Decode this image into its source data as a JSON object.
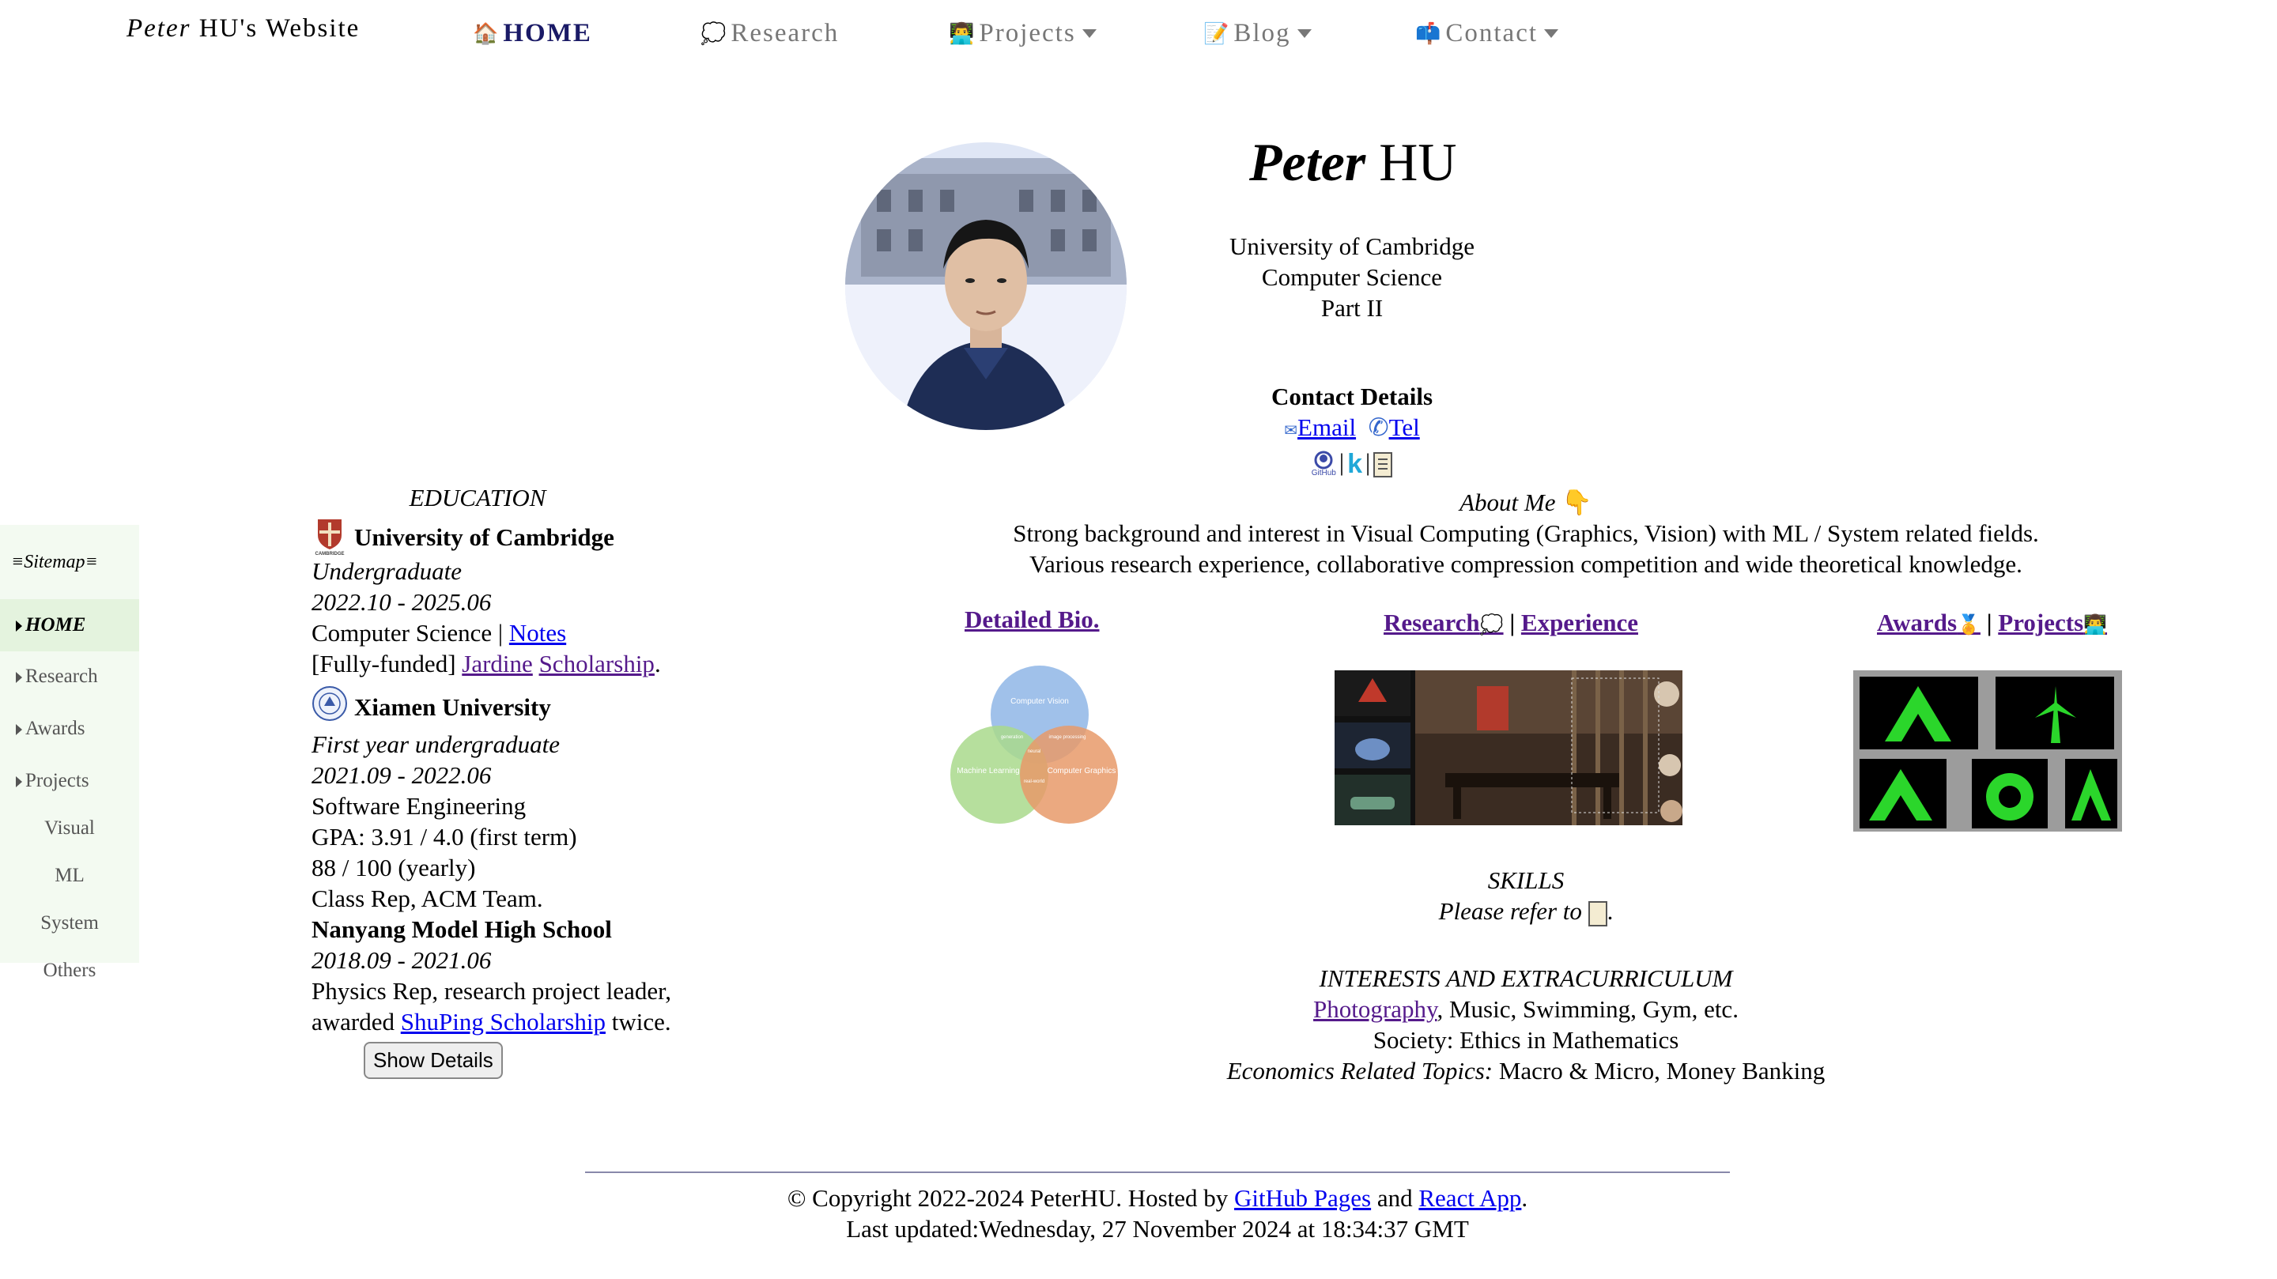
{
  "nav": {
    "brand_italic": "Peter",
    "brand_rest": " HU's Website",
    "items": [
      {
        "icon": "🏠",
        "label": "HOME"
      },
      {
        "icon": "💭",
        "label": "Research"
      },
      {
        "icon": "👨‍💻",
        "label": "Projects"
      },
      {
        "icon": "📝",
        "label": "Blog"
      },
      {
        "icon": "📫",
        "label": "Contact"
      }
    ]
  },
  "sitemap": {
    "title": "Sitemap",
    "items": [
      "HOME",
      "Research",
      "Awards",
      "Projects"
    ],
    "sub_items": [
      "Visual",
      "ML",
      "System",
      "Others"
    ]
  },
  "profile": {
    "first": "Peter",
    "last": "HU",
    "lines": [
      "University of Cambridge",
      "Computer Science",
      "Part II"
    ],
    "contact_title": "Contact Details",
    "email": "Email",
    "tel": "Tel"
  },
  "education": {
    "title": "EDUCATION",
    "cambridge": {
      "name": "University of Cambridge",
      "level": "Undergraduate",
      "dates": "2022.10 - 2025.06",
      "subject": "Computer Science",
      "notes": "Notes",
      "funded": "[Fully-funded]",
      "jardine": "Jardine",
      "scholarship": "Scholarship"
    },
    "xiamen": {
      "name": "Xiamen University",
      "level": "First year undergraduate",
      "dates": "2021.09 - 2022.06",
      "subject": "Software Engineering",
      "gpa": "GPA: 3.91 / 4.0 (first term)",
      "yearly": "88 / 100 (yearly)",
      "role": "Class Rep, ACM Team."
    },
    "nanyang": {
      "name": "Nanyang Model High School",
      "dates": "2018.09 - 2021.06",
      "line1": "Physics Rep, research project leader,",
      "awarded": "awarded",
      "shuping": "ShuPing Scholarship",
      "twice": "twice."
    },
    "button": "Show Details"
  },
  "about": {
    "title": "About Me",
    "line1": "Strong background and interest in Visual Computing (Graphics, Vision) with ML / System related fields.",
    "line2": "Various research experience, collaborative compression competition and wide theoretical knowledge."
  },
  "columns": {
    "bio": "Detailed Bio.",
    "research": "Research",
    "experience": "Experience",
    "awards": "Awards",
    "projects": "Projects",
    "venn": {
      "vision": "Computer Vision",
      "ml": "Machine Learning",
      "graphics": "Computer Graphics",
      "generation": "generation",
      "image_processing": "image processing",
      "neural": "neural",
      "real_world": "real-world"
    }
  },
  "skills": {
    "title": "SKILLS",
    "refer": "Please refer to"
  },
  "interests": {
    "title": "INTERESTS AND EXTRACURRICULUM",
    "photography": "Photography",
    "rest": ", Music, Swimming, Gym, etc.",
    "society": "Society: Ethics in Mathematics",
    "econ_label": "Economics Related Topics:",
    "econ_rest": " Macro & Micro, Money Banking"
  },
  "footer": {
    "copyright": "© Copyright 2022-2024 PeterHU. Hosted by ",
    "github": "GitHub Pages",
    "and": " and ",
    "react": "React App",
    "dot": ".",
    "updated": "Last updated:Wednesday, 27 November 2024 at 18:34:37 GMT"
  },
  "colors": {
    "link": "#0000ee",
    "visited": "#551a8b",
    "sitemap_bg": "#f3faf1",
    "venn_blue": "#8fb6e6",
    "venn_green": "#a9d98c",
    "venn_orange": "#e89a6a"
  }
}
